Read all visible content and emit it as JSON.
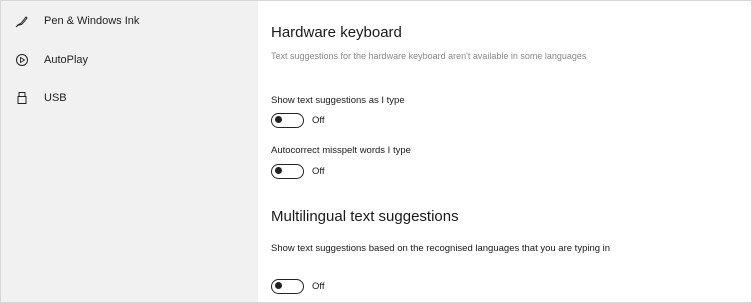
{
  "sidebar": {
    "items": [
      {
        "label": "Pen & Windows Ink",
        "icon": "pen-icon"
      },
      {
        "label": "AutoPlay",
        "icon": "autoplay-icon"
      },
      {
        "label": "USB",
        "icon": "usb-icon"
      }
    ]
  },
  "hardware_keyboard": {
    "heading": "Hardware keyboard",
    "description": "Text suggestions for the hardware keyboard aren't available in some languages",
    "settings": [
      {
        "label": "Show text suggestions as I type",
        "state": "Off",
        "on": false
      },
      {
        "label": "Autocorrect misspelt words I type",
        "state": "Off",
        "on": false
      }
    ]
  },
  "multilingual": {
    "heading": "Multilingual text suggestions",
    "settings": [
      {
        "label": "Show text suggestions based on the recognised languages that you are typing in",
        "state": "Off",
        "on": false
      }
    ]
  },
  "colors": {
    "sidebar_bg": "#f1f1f1",
    "content_bg": "#ffffff",
    "description_text": "#8a8a8a",
    "toggle_off": "#222222"
  }
}
